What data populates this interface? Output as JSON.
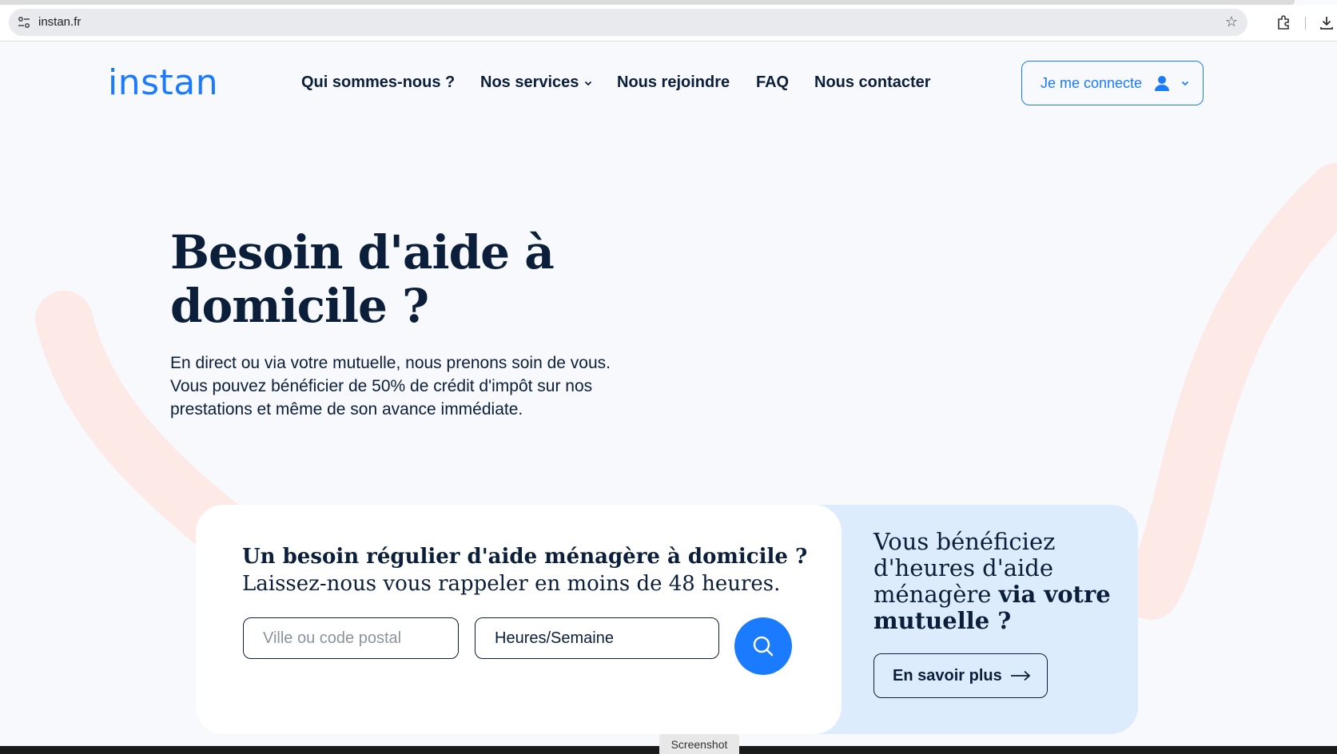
{
  "browser": {
    "url": "instan.fr",
    "icons": [
      "site-settings-icon",
      "star-icon",
      "extensions-icon",
      "download-icon"
    ]
  },
  "header": {
    "logo": "instan",
    "nav": [
      {
        "label": "Qui sommes-nous ?"
      },
      {
        "label": "Nos services"
      },
      {
        "label": "Nous rejoindre"
      },
      {
        "label": "FAQ"
      },
      {
        "label": "Nous contacter"
      }
    ],
    "login_label": "Je me connecte"
  },
  "hero": {
    "title": "Besoin d'aide à domicile ?",
    "text": "En direct ou via votre mutuelle, nous prenons soin de vous. Vous pouvez bénéficier de 50% de crédit d'impôt sur nos prestations et même de son avance immédiate."
  },
  "search_card": {
    "title": "Un besoin régulier d'aide ménagère à domicile ?",
    "subtitle": "Laissez-nous vous rappeler en moins de 48 heures.",
    "city_placeholder": "Ville ou code postal",
    "hours_value": "Heures/Semaine"
  },
  "mutuelle_card": {
    "title_plain": "Vous bénéficiez d'heures d'aide ménagère ",
    "title_bold": "via votre mutuelle ?",
    "button_label": "En savoir plus"
  },
  "footer": {
    "screenshot_label": "Screenshot"
  },
  "colors": {
    "accent": "#1b7bff",
    "text": "#0b1f3a",
    "background": "#f7f9fc",
    "card_blue": "#dcecfc",
    "deco": "#fde9e6"
  }
}
